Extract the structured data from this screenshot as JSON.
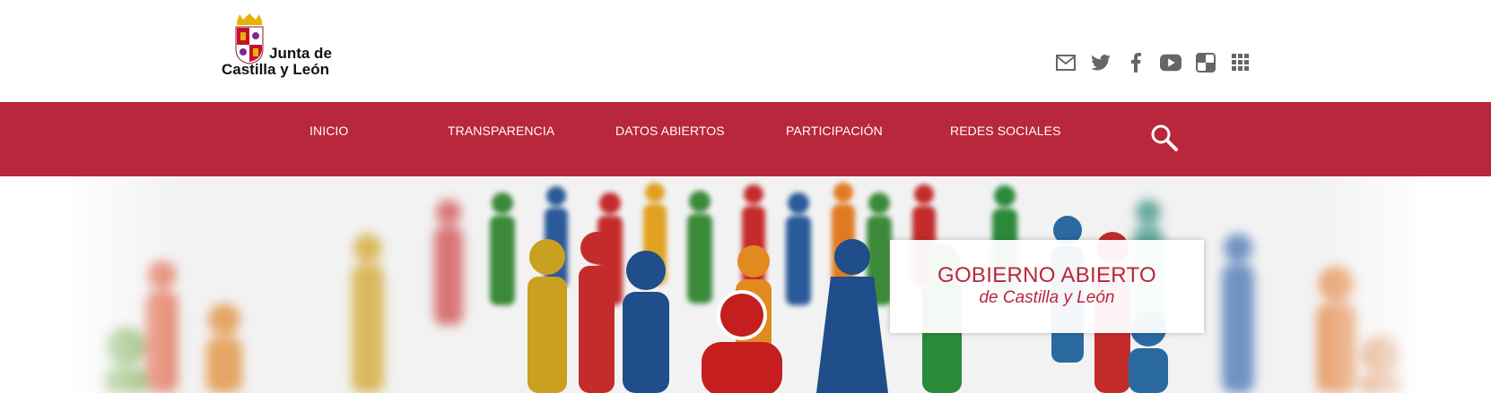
{
  "logo": {
    "line1": "Junta de",
    "line2": "Castilla y León"
  },
  "social": [
    {
      "name": "mail-icon"
    },
    {
      "name": "twitter-icon"
    },
    {
      "name": "facebook-icon"
    },
    {
      "name": "youtube-icon"
    },
    {
      "name": "blog-icon"
    },
    {
      "name": "apps-grid-icon"
    }
  ],
  "nav": {
    "items": [
      "INICIO",
      "TRANSPARENCIA",
      "DATOS ABIERTOS",
      "PARTICIPACIÓN",
      "REDES SOCIALES"
    ]
  },
  "hero": {
    "title": "GOBIERNO ABIERTO",
    "subtitle": "de Castilla y León"
  },
  "colors": {
    "brand": "#b8273b",
    "icon": "#666666"
  }
}
